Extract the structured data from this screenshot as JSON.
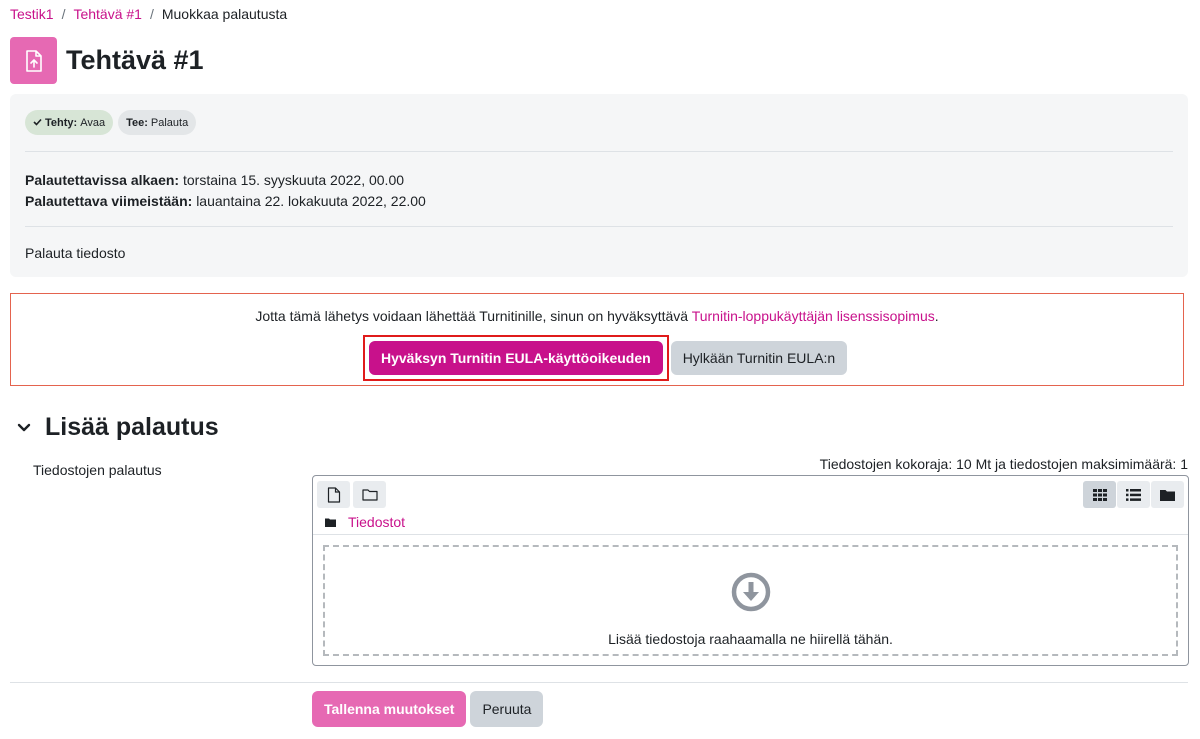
{
  "breadcrumb": {
    "course": "Testik1",
    "assignment": "Tehtävä #1",
    "current": "Muokkaa palautusta"
  },
  "page": {
    "title": "Tehtävä #1",
    "icon": "assignment-upload-icon"
  },
  "activity_info": {
    "badges": [
      {
        "label": "Tehty:",
        "value": "Avaa",
        "icon": "check-icon"
      },
      {
        "label": "Tee:",
        "value": "Palauta"
      }
    ],
    "open_label": "Palautettavissa alkaen:",
    "open_value": "torstaina 15. syyskuuta 2022, 00.00",
    "due_label": "Palautettava viimeistään:",
    "due_value": "lauantaina 22. lokakuuta 2022, 22.00",
    "description": "Palauta tiedosto"
  },
  "eula": {
    "text": "Jotta tämä lähetys voidaan lähettää Turnitinille, sinun on hyväksyttävä ",
    "link": "Turnitin-loppukäyttäjän lisenssisopimus",
    "link_suffix": ".",
    "accept_label": "Hyväksyn Turnitin EULA-käyttöoikeuden",
    "decline_label": "Hylkään Turnitin EULA:n"
  },
  "section": {
    "title": "Lisää palautus",
    "field_label": "Tiedostojen palautus",
    "limits": "Tiedostojen kokoraja: 10 Mt ja tiedostojen maksimimäärä: 1"
  },
  "filemanager": {
    "path_label": "Tiedostot",
    "drop_text": "Lisää tiedostoja raahaamalla ne hiirellä tähän.",
    "tools_left": [
      "add-file-icon",
      "create-folder-icon"
    ],
    "views": [
      "icon-view-icon",
      "list-view-icon",
      "tree-view-icon"
    ]
  },
  "form": {
    "save_label": "Tallenna muutokset",
    "cancel_label": "Peruuta"
  },
  "colors": {
    "brand": "#c8118b",
    "assignment_icon": "#e669b3",
    "eula_border": "#e4634e",
    "highlight_border": "#e01b1b"
  }
}
